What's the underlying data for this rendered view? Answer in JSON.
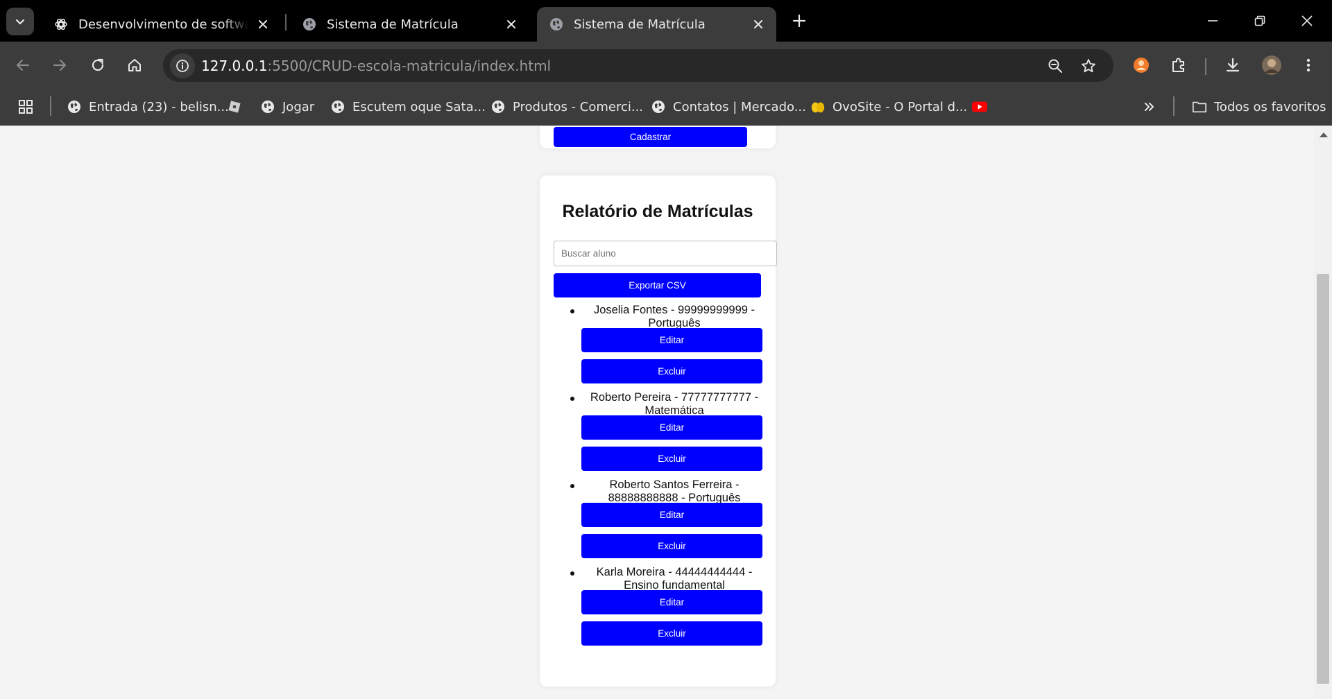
{
  "browser": {
    "tabs": [
      {
        "title": "Desenvolvimento de software w",
        "active": false,
        "favicon": "openai-icon"
      },
      {
        "title": "Sistema de Matrícula",
        "active": false,
        "favicon": "globe-icon"
      },
      {
        "title": "Sistema de Matrícula",
        "active": true,
        "favicon": "globe-icon"
      }
    ],
    "url_host": "127.0.0.1",
    "url_rest": ":5500/CRUD-escola-matricula/index.html",
    "bookmarks": [
      {
        "label": "Entrada (23) - belisn...",
        "icon": "globe-icon"
      },
      {
        "label": "",
        "icon": "roblox-icon"
      },
      {
        "label": "Jogar",
        "icon": "globe-icon"
      },
      {
        "label": "Escutem oque Sata...",
        "icon": "globe-icon"
      },
      {
        "label": "Produtos - Comerci...",
        "icon": "globe-icon"
      },
      {
        "label": "Contatos | Mercado...",
        "icon": "globe-icon"
      },
      {
        "label": "OvoSite - O Portal d...",
        "icon": "eggs-icon"
      },
      {
        "label": "",
        "icon": "youtube-icon"
      }
    ],
    "all_bookmarks_label": "Todos os favoritos",
    "colors": {
      "tabstrip": "#000000",
      "toolbar": "#3c3c3c",
      "omnibox": "#282828"
    }
  },
  "page": {
    "register_button": "Cadastrar",
    "report_title": "Relatório de Matrículas",
    "search_placeholder": "Buscar aluno",
    "search_value": "",
    "export_button": "Exportar CSV",
    "edit_label": "Editar",
    "delete_label": "Excluir",
    "students": [
      {
        "line1": "Joselia Fontes - 99999999999 -",
        "line2": "Português"
      },
      {
        "line1": "Roberto Pereira - 77777777777 -",
        "line2": "Matemática"
      },
      {
        "line1": "Roberto Santos Ferreira -",
        "line2": "88888888888 - Português"
      },
      {
        "line1": "Karla Moreira - 44444444444 -",
        "line2": "Ensino fundamental"
      }
    ],
    "colors": {
      "button": "#0000ff",
      "background": "#f4f4f4",
      "card": "#ffffff"
    }
  }
}
